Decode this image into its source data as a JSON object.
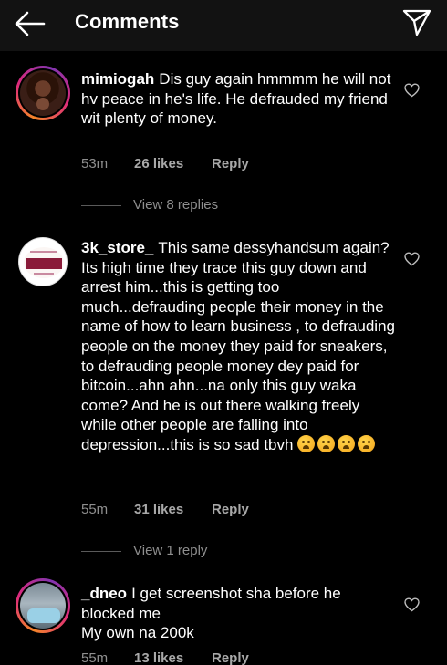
{
  "header": {
    "title": "Comments",
    "back_icon": "arrow-left-icon",
    "send_icon": "paper-plane-icon"
  },
  "comments": [
    {
      "username": "mimiogah",
      "text": "Dis guy again hmmmm he will not hv peace in he's life.  He defrauded my friend wit plenty of money.",
      "time": "53m",
      "likes": "26 likes",
      "reply": "Reply",
      "view_replies": "View 8 replies"
    },
    {
      "username": "3k_store_",
      "text": "This same dessyhandsum again? Its high time they trace this guy down and arrest him...this is getting too much...defrauding people their money in the name of how to learn business , to defrauding people on the money they paid for sneakers, to defrauding people money dey paid for bitcoin...ahn ahn...na only this guy waka come? And he is out there walking freely while other people are falling into depression...this is so sad tbvh",
      "emoji_count": 4,
      "emoji_name": "crying-face",
      "time": "55m",
      "likes": "31 likes",
      "reply": "Reply",
      "view_replies": "View 1 reply"
    },
    {
      "username": "_dneo",
      "text": "I get screenshot sha before he blocked me",
      "text_line2": "My own na 200k",
      "time": "55m",
      "likes": "13 likes",
      "reply": "Reply"
    }
  ],
  "colors": {
    "background": "#000000",
    "header_bg": "#121212",
    "secondary_text": "#8e8e8e"
  }
}
